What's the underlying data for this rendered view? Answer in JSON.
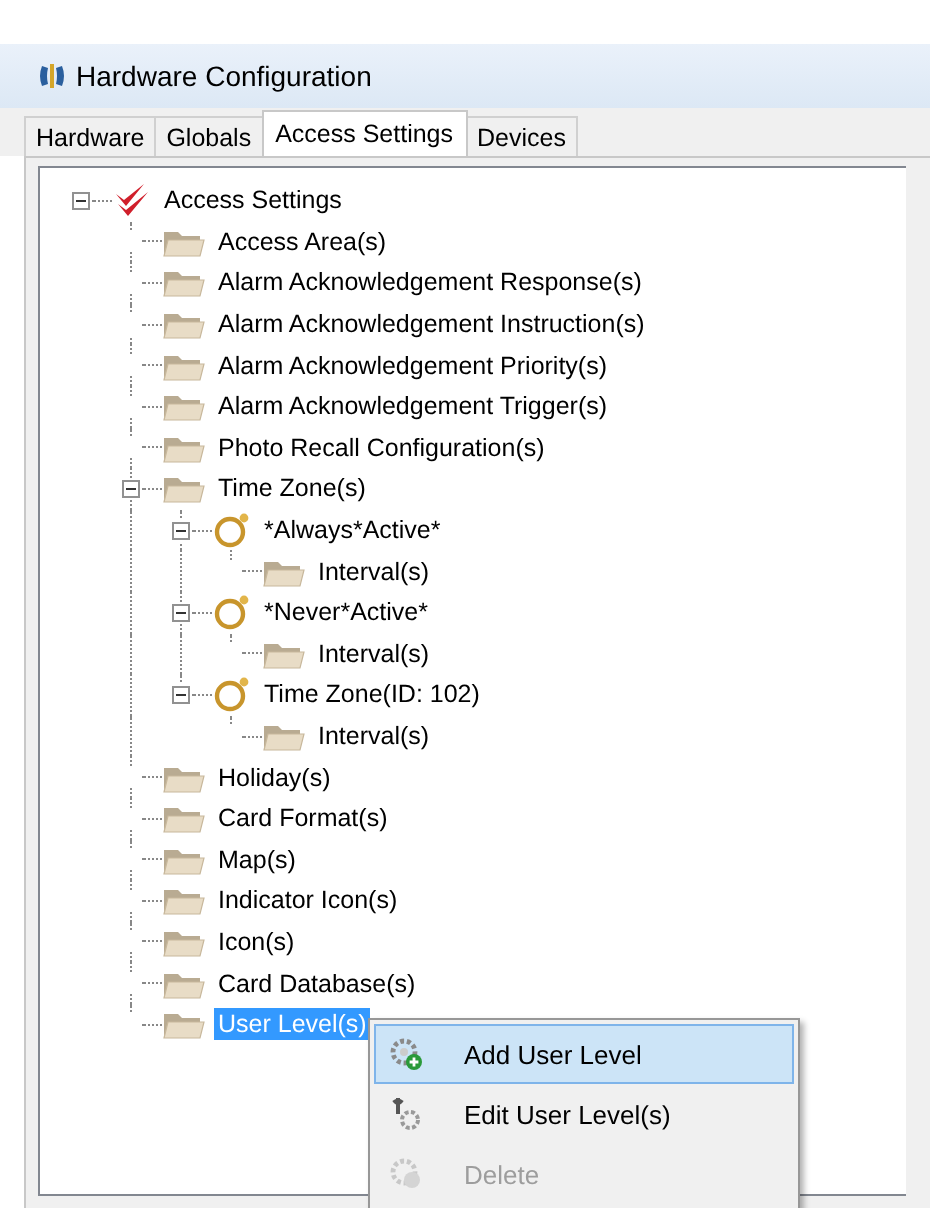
{
  "window": {
    "title": "Hardware Configuration"
  },
  "tabs": [
    {
      "label": "Hardware",
      "selected": false
    },
    {
      "label": "Globals",
      "selected": false
    },
    {
      "label": "Access Settings",
      "selected": true
    },
    {
      "label": "Devices",
      "selected": false
    }
  ],
  "tree": [
    {
      "label": "Access Settings",
      "kind": "root",
      "expanded": true,
      "selected": false,
      "children": [
        {
          "label": "Access Area(s)",
          "kind": "folder",
          "selected": false
        },
        {
          "label": "Alarm Acknowledgement Response(s)",
          "kind": "folder",
          "selected": false
        },
        {
          "label": "Alarm Acknowledgement Instruction(s)",
          "kind": "folder",
          "selected": false
        },
        {
          "label": "Alarm Acknowledgement Priority(s)",
          "kind": "folder",
          "selected": false
        },
        {
          "label": "Alarm Acknowledgement Trigger(s)",
          "kind": "folder",
          "selected": false
        },
        {
          "label": "Photo Recall Configuration(s)",
          "kind": "folder",
          "selected": false
        },
        {
          "label": "Time Zone(s)",
          "kind": "folder",
          "expanded": true,
          "selected": false,
          "children": [
            {
              "label": "*Always*Active*",
              "kind": "timezone",
              "expanded": true,
              "selected": false,
              "children": [
                {
                  "label": "Interval(s)",
                  "kind": "folder",
                  "selected": false
                }
              ]
            },
            {
              "label": "*Never*Active*",
              "kind": "timezone",
              "expanded": true,
              "selected": false,
              "children": [
                {
                  "label": "Interval(s)",
                  "kind": "folder",
                  "selected": false
                }
              ]
            },
            {
              "label": "Time Zone(ID: 102)",
              "kind": "timezone",
              "expanded": true,
              "selected": false,
              "children": [
                {
                  "label": "Interval(s)",
                  "kind": "folder",
                  "selected": false
                }
              ]
            }
          ]
        },
        {
          "label": "Holiday(s)",
          "kind": "folder",
          "selected": false
        },
        {
          "label": "Card Format(s)",
          "kind": "folder",
          "selected": false
        },
        {
          "label": "Map(s)",
          "kind": "folder",
          "selected": false
        },
        {
          "label": "Indicator Icon(s)",
          "kind": "folder",
          "selected": false
        },
        {
          "label": "Icon(s)",
          "kind": "folder",
          "selected": false
        },
        {
          "label": "Card Database(s)",
          "kind": "folder",
          "selected": false
        },
        {
          "label": "User Level(s)",
          "kind": "folder",
          "selected": true
        }
      ]
    }
  ],
  "context_menu": [
    {
      "label": "Add User Level",
      "kind": "add",
      "selected": true,
      "disabled": false
    },
    {
      "label": "Edit User Level(s)",
      "kind": "edit",
      "selected": false,
      "disabled": false
    },
    {
      "label": "Delete",
      "kind": "delete",
      "selected": false,
      "disabled": true
    }
  ]
}
